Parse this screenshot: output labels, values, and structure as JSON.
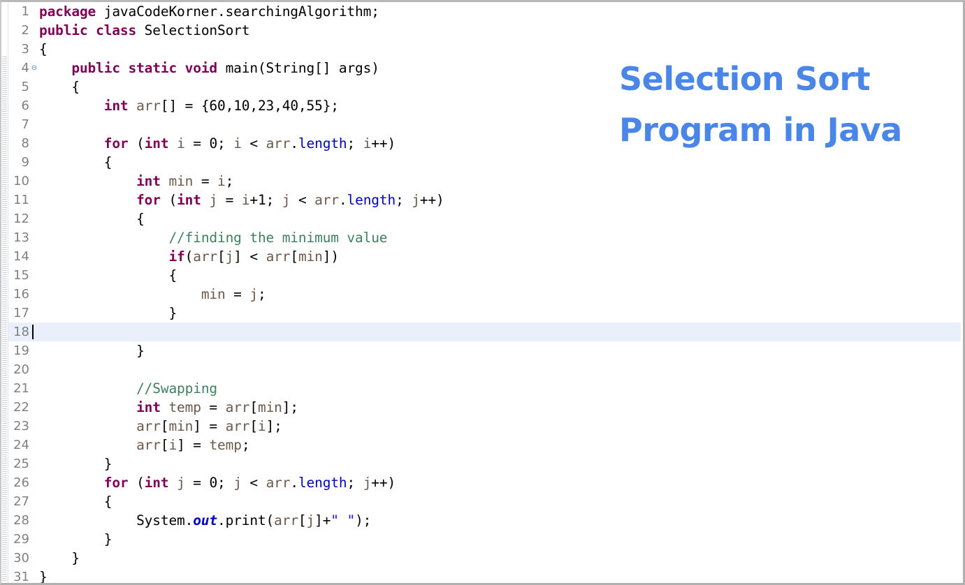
{
  "slide": {
    "title_lines": [
      "Selection Sort",
      "Program in Java"
    ],
    "title_color": "#4a86e8"
  },
  "editor": {
    "language": "java",
    "current_line": 18,
    "caret_line": 18,
    "current_line_highlight_color": "#e9f0fb",
    "background_color": "#ffffff",
    "gutter_text_color": "#808080",
    "fold_marker_glyph": "⊖",
    "fold_marker_line": 4,
    "total_lines": 31,
    "syntax_colors": {
      "keyword": "#7f0055",
      "comment": "#3f7f5f",
      "field": "#0000c0",
      "static_field": "#0000c0",
      "string": "#2a00ff",
      "local_variable": "#6a5a4c",
      "plain": "#000000"
    },
    "lines": [
      {
        "n": "1",
        "fold": false,
        "tokens": [
          {
            "t": "package",
            "c": "tok-keyword"
          },
          {
            "t": " javaCodeKorner.searchingAlgorithm;",
            "c": "tok-plain"
          }
        ]
      },
      {
        "n": "2",
        "fold": false,
        "tokens": [
          {
            "t": "public class",
            "c": "tok-keyword"
          },
          {
            "t": " SelectionSort",
            "c": "tok-plain"
          }
        ]
      },
      {
        "n": "3",
        "fold": false,
        "tokens": [
          {
            "t": "{",
            "c": "tok-plain"
          }
        ]
      },
      {
        "n": "4",
        "fold": true,
        "tokens": [
          {
            "t": "    ",
            "c": "tok-plain"
          },
          {
            "t": "public static void",
            "c": "tok-keyword"
          },
          {
            "t": " main(String[] args)",
            "c": "tok-plain"
          }
        ]
      },
      {
        "n": "5",
        "fold": false,
        "tokens": [
          {
            "t": "    {",
            "c": "tok-plain"
          }
        ]
      },
      {
        "n": "6",
        "fold": false,
        "tokens": [
          {
            "t": "        ",
            "c": "tok-plain"
          },
          {
            "t": "int",
            "c": "tok-keyword"
          },
          {
            "t": " ",
            "c": "tok-plain"
          },
          {
            "t": "arr",
            "c": "tok-local"
          },
          {
            "t": "[] = {60,10,23,40,55};",
            "c": "tok-plain"
          }
        ]
      },
      {
        "n": "7",
        "fold": false,
        "tokens": [
          {
            "t": "",
            "c": "tok-plain"
          }
        ]
      },
      {
        "n": "8",
        "fold": false,
        "tokens": [
          {
            "t": "        ",
            "c": "tok-plain"
          },
          {
            "t": "for",
            "c": "tok-keyword"
          },
          {
            "t": " (",
            "c": "tok-plain"
          },
          {
            "t": "int",
            "c": "tok-keyword"
          },
          {
            "t": " ",
            "c": "tok-plain"
          },
          {
            "t": "i",
            "c": "tok-local"
          },
          {
            "t": " = 0; ",
            "c": "tok-plain"
          },
          {
            "t": "i",
            "c": "tok-local"
          },
          {
            "t": " < ",
            "c": "tok-plain"
          },
          {
            "t": "arr",
            "c": "tok-local"
          },
          {
            "t": ".",
            "c": "tok-plain"
          },
          {
            "t": "length",
            "c": "tok-field"
          },
          {
            "t": "; ",
            "c": "tok-plain"
          },
          {
            "t": "i",
            "c": "tok-local"
          },
          {
            "t": "++)",
            "c": "tok-plain"
          }
        ]
      },
      {
        "n": "9",
        "fold": false,
        "tokens": [
          {
            "t": "        {",
            "c": "tok-plain"
          }
        ]
      },
      {
        "n": "10",
        "fold": false,
        "tokens": [
          {
            "t": "            ",
            "c": "tok-plain"
          },
          {
            "t": "int",
            "c": "tok-keyword"
          },
          {
            "t": " ",
            "c": "tok-plain"
          },
          {
            "t": "min",
            "c": "tok-local"
          },
          {
            "t": " = ",
            "c": "tok-plain"
          },
          {
            "t": "i",
            "c": "tok-local"
          },
          {
            "t": ";",
            "c": "tok-plain"
          }
        ]
      },
      {
        "n": "11",
        "fold": false,
        "tokens": [
          {
            "t": "            ",
            "c": "tok-plain"
          },
          {
            "t": "for",
            "c": "tok-keyword"
          },
          {
            "t": " (",
            "c": "tok-plain"
          },
          {
            "t": "int",
            "c": "tok-keyword"
          },
          {
            "t": " ",
            "c": "tok-plain"
          },
          {
            "t": "j",
            "c": "tok-local"
          },
          {
            "t": " = ",
            "c": "tok-plain"
          },
          {
            "t": "i",
            "c": "tok-local"
          },
          {
            "t": "+1; ",
            "c": "tok-plain"
          },
          {
            "t": "j",
            "c": "tok-local"
          },
          {
            "t": " < ",
            "c": "tok-plain"
          },
          {
            "t": "arr",
            "c": "tok-local"
          },
          {
            "t": ".",
            "c": "tok-plain"
          },
          {
            "t": "length",
            "c": "tok-field"
          },
          {
            "t": "; ",
            "c": "tok-plain"
          },
          {
            "t": "j",
            "c": "tok-local"
          },
          {
            "t": "++)",
            "c": "tok-plain"
          }
        ]
      },
      {
        "n": "12",
        "fold": false,
        "tokens": [
          {
            "t": "            {",
            "c": "tok-plain"
          }
        ]
      },
      {
        "n": "13",
        "fold": false,
        "tokens": [
          {
            "t": "                ",
            "c": "tok-plain"
          },
          {
            "t": "//finding the minimum value",
            "c": "tok-comment"
          }
        ]
      },
      {
        "n": "14",
        "fold": false,
        "tokens": [
          {
            "t": "                ",
            "c": "tok-plain"
          },
          {
            "t": "if",
            "c": "tok-keyword"
          },
          {
            "t": "(",
            "c": "tok-plain"
          },
          {
            "t": "arr",
            "c": "tok-local"
          },
          {
            "t": "[",
            "c": "tok-plain"
          },
          {
            "t": "j",
            "c": "tok-local"
          },
          {
            "t": "] < ",
            "c": "tok-plain"
          },
          {
            "t": "arr",
            "c": "tok-local"
          },
          {
            "t": "[",
            "c": "tok-plain"
          },
          {
            "t": "min",
            "c": "tok-local"
          },
          {
            "t": "])",
            "c": "tok-plain"
          }
        ]
      },
      {
        "n": "15",
        "fold": false,
        "tokens": [
          {
            "t": "                {",
            "c": "tok-plain"
          }
        ]
      },
      {
        "n": "16",
        "fold": false,
        "tokens": [
          {
            "t": "                    ",
            "c": "tok-plain"
          },
          {
            "t": "min",
            "c": "tok-local"
          },
          {
            "t": " = ",
            "c": "tok-plain"
          },
          {
            "t": "j",
            "c": "tok-local"
          },
          {
            "t": ";",
            "c": "tok-plain"
          }
        ]
      },
      {
        "n": "17",
        "fold": false,
        "tokens": [
          {
            "t": "                }",
            "c": "tok-plain"
          }
        ]
      },
      {
        "n": "18",
        "fold": false,
        "tokens": [
          {
            "t": "",
            "c": "tok-plain"
          }
        ]
      },
      {
        "n": "19",
        "fold": false,
        "tokens": [
          {
            "t": "            }",
            "c": "tok-plain"
          }
        ]
      },
      {
        "n": "20",
        "fold": false,
        "tokens": [
          {
            "t": "",
            "c": "tok-plain"
          }
        ]
      },
      {
        "n": "21",
        "fold": false,
        "tokens": [
          {
            "t": "            ",
            "c": "tok-plain"
          },
          {
            "t": "//Swapping",
            "c": "tok-comment"
          }
        ]
      },
      {
        "n": "22",
        "fold": false,
        "tokens": [
          {
            "t": "            ",
            "c": "tok-plain"
          },
          {
            "t": "int",
            "c": "tok-keyword"
          },
          {
            "t": " ",
            "c": "tok-plain"
          },
          {
            "t": "temp",
            "c": "tok-local"
          },
          {
            "t": " = ",
            "c": "tok-plain"
          },
          {
            "t": "arr",
            "c": "tok-local"
          },
          {
            "t": "[",
            "c": "tok-plain"
          },
          {
            "t": "min",
            "c": "tok-local"
          },
          {
            "t": "];",
            "c": "tok-plain"
          }
        ]
      },
      {
        "n": "23",
        "fold": false,
        "tokens": [
          {
            "t": "            ",
            "c": "tok-plain"
          },
          {
            "t": "arr",
            "c": "tok-local"
          },
          {
            "t": "[",
            "c": "tok-plain"
          },
          {
            "t": "min",
            "c": "tok-local"
          },
          {
            "t": "] = ",
            "c": "tok-plain"
          },
          {
            "t": "arr",
            "c": "tok-local"
          },
          {
            "t": "[",
            "c": "tok-plain"
          },
          {
            "t": "i",
            "c": "tok-local"
          },
          {
            "t": "];",
            "c": "tok-plain"
          }
        ]
      },
      {
        "n": "24",
        "fold": false,
        "tokens": [
          {
            "t": "            ",
            "c": "tok-plain"
          },
          {
            "t": "arr",
            "c": "tok-local"
          },
          {
            "t": "[",
            "c": "tok-plain"
          },
          {
            "t": "i",
            "c": "tok-local"
          },
          {
            "t": "] = ",
            "c": "tok-plain"
          },
          {
            "t": "temp",
            "c": "tok-local"
          },
          {
            "t": ";",
            "c": "tok-plain"
          }
        ]
      },
      {
        "n": "25",
        "fold": false,
        "tokens": [
          {
            "t": "        }",
            "c": "tok-plain"
          }
        ]
      },
      {
        "n": "26",
        "fold": false,
        "tokens": [
          {
            "t": "        ",
            "c": "tok-plain"
          },
          {
            "t": "for",
            "c": "tok-keyword"
          },
          {
            "t": " (",
            "c": "tok-plain"
          },
          {
            "t": "int",
            "c": "tok-keyword"
          },
          {
            "t": " ",
            "c": "tok-plain"
          },
          {
            "t": "j",
            "c": "tok-local"
          },
          {
            "t": " = 0; ",
            "c": "tok-plain"
          },
          {
            "t": "j",
            "c": "tok-local"
          },
          {
            "t": " < ",
            "c": "tok-plain"
          },
          {
            "t": "arr",
            "c": "tok-local"
          },
          {
            "t": ".",
            "c": "tok-plain"
          },
          {
            "t": "length",
            "c": "tok-field"
          },
          {
            "t": "; ",
            "c": "tok-plain"
          },
          {
            "t": "j",
            "c": "tok-local"
          },
          {
            "t": "++)",
            "c": "tok-plain"
          }
        ]
      },
      {
        "n": "27",
        "fold": false,
        "tokens": [
          {
            "t": "        {",
            "c": "tok-plain"
          }
        ]
      },
      {
        "n": "28",
        "fold": false,
        "tokens": [
          {
            "t": "            System.",
            "c": "tok-plain"
          },
          {
            "t": "out",
            "c": "tok-static"
          },
          {
            "t": ".print(",
            "c": "tok-plain"
          },
          {
            "t": "arr",
            "c": "tok-local"
          },
          {
            "t": "[",
            "c": "tok-plain"
          },
          {
            "t": "j",
            "c": "tok-local"
          },
          {
            "t": "]+",
            "c": "tok-plain"
          },
          {
            "t": "\" \"",
            "c": "tok-string"
          },
          {
            "t": ");",
            "c": "tok-plain"
          }
        ]
      },
      {
        "n": "29",
        "fold": false,
        "tokens": [
          {
            "t": "        }",
            "c": "tok-plain"
          }
        ]
      },
      {
        "n": "30",
        "fold": false,
        "tokens": [
          {
            "t": "    }",
            "c": "tok-plain"
          }
        ]
      },
      {
        "n": "31",
        "fold": false,
        "tokens": [
          {
            "t": "}",
            "c": "tok-plain"
          }
        ]
      }
    ]
  }
}
